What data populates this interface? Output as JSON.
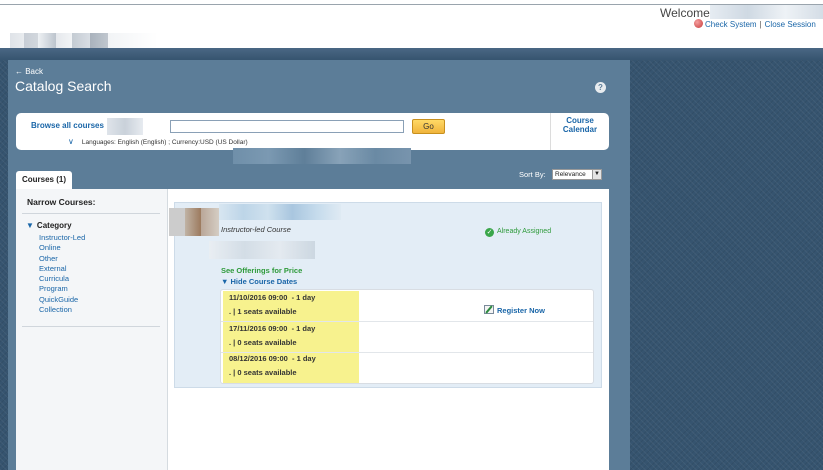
{
  "header": {
    "welcome": "Welcome",
    "links": [
      "Check System",
      "Close Session"
    ]
  },
  "page": {
    "back": "← Back",
    "title": "Catalog Search",
    "help": "?"
  },
  "search": {
    "browse_label": "Browse all courses",
    "input_value": "",
    "go_label": "Go",
    "calendar_label": [
      "Course",
      "Calendar"
    ],
    "languages_text": "Languages: English (English) ; Currency:USD (US Dollar)"
  },
  "sort": {
    "label": "Sort By:",
    "selected": "Relevance"
  },
  "tab": {
    "label": "Courses (1)"
  },
  "sidebar": {
    "heading": "Narrow Courses:",
    "category_title": "Category",
    "items": [
      "Instructor-Led",
      "Online",
      "Other",
      "External",
      "Curricula",
      "Program",
      "QuickGuide",
      "Collection"
    ]
  },
  "result": {
    "type": "Instructor-led Course",
    "status": "Already Assigned",
    "offerings_link": "See Offerings for Price",
    "hide_dates": "Hide Course Dates",
    "register": "Register Now",
    "sessions": [
      {
        "date": "11/10/2016 09:00",
        "duration": "- 1 day",
        "seats": ". | 1 seats available"
      },
      {
        "date": "17/11/2016 09:00",
        "duration": "- 1 day",
        "seats": ". | 0 seats available"
      },
      {
        "date": "08/12/2016 09:00",
        "duration": "- 1 day",
        "seats": ". | 0 seats available"
      }
    ]
  },
  "colors": {
    "link": "#1a66a8",
    "success": "#2e9a3a",
    "highlight": "#f7f28e",
    "panel": "#5c7d98",
    "background": "#36546f"
  }
}
